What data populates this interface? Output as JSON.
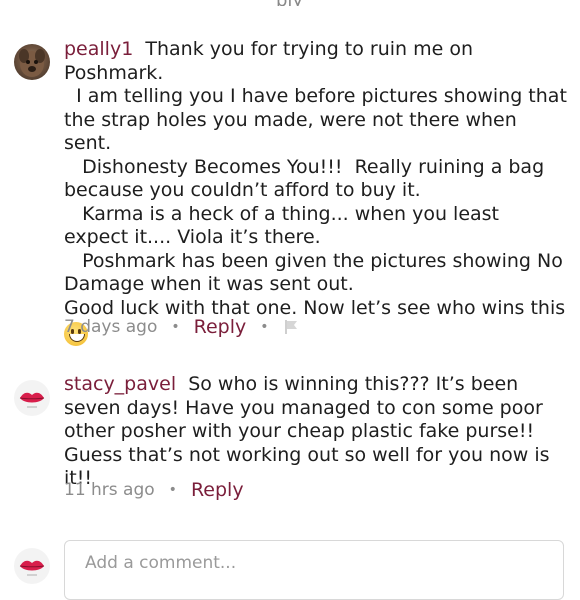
{
  "comments": [
    {
      "username": "peally1",
      "avatar": "dog-photo-avatar",
      "text": "  Thank you for trying to ruin me on Poshmark.\n  I am telling you I have before pictures showing that the strap holes you made, were not there when sent.\n   Dishonesty Becomes You!!!  Really ruining a bag because you couldn’t afford to buy it.\n   Karma is a heck of a thing... when you least expect it.... Viola it’s there.\n   Poshmark has been given the pictures showing No Damage when it was sent out.\nGood luck with that one. Now let’s see who wins this ",
      "emoji": "grinning-face-emoji",
      "time": "7 days ago",
      "reply_label": "Reply",
      "has_flag": true
    },
    {
      "username": "stacy_pavel",
      "avatar": "lips-logo-avatar",
      "text": "  So who is winning this??? It’s been seven days! Have you managed to con some poor other posher with your cheap plastic fake purse!! Guess that’s not working out so well for you now is it!!",
      "time": "11 hrs ago",
      "reply_label": "Reply",
      "has_flag": false
    }
  ],
  "composer": {
    "avatar": "lips-logo-avatar",
    "placeholder": "Add a comment..."
  },
  "colors": {
    "username": "#7a1e3a",
    "reply": "#7a1e3a",
    "meta": "#8c8c8c",
    "text": "#1e1e1e"
  }
}
